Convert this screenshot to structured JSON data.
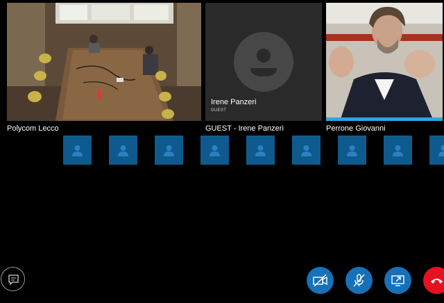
{
  "tiles": {
    "room": {
      "label": "Polycom Lecco"
    },
    "guest": {
      "label": "GUEST - Irene Panzeri",
      "name": "Irene Panzeri",
      "subtitle": "GUEST"
    },
    "person": {
      "label": "Perrone Giovanni"
    }
  },
  "participants_count": 9,
  "controls": {
    "chat": "chat-icon",
    "video_off": "video-off-icon",
    "mic_muted": "mic-muted-icon",
    "share": "share-screen-icon",
    "hang_up": "hang-up-icon"
  },
  "colors": {
    "participant_tile": "#0e5a8c",
    "control_blue": "#1671b8",
    "hang_up_red": "#e81123",
    "active_speaker": "#2ea6e0"
  }
}
